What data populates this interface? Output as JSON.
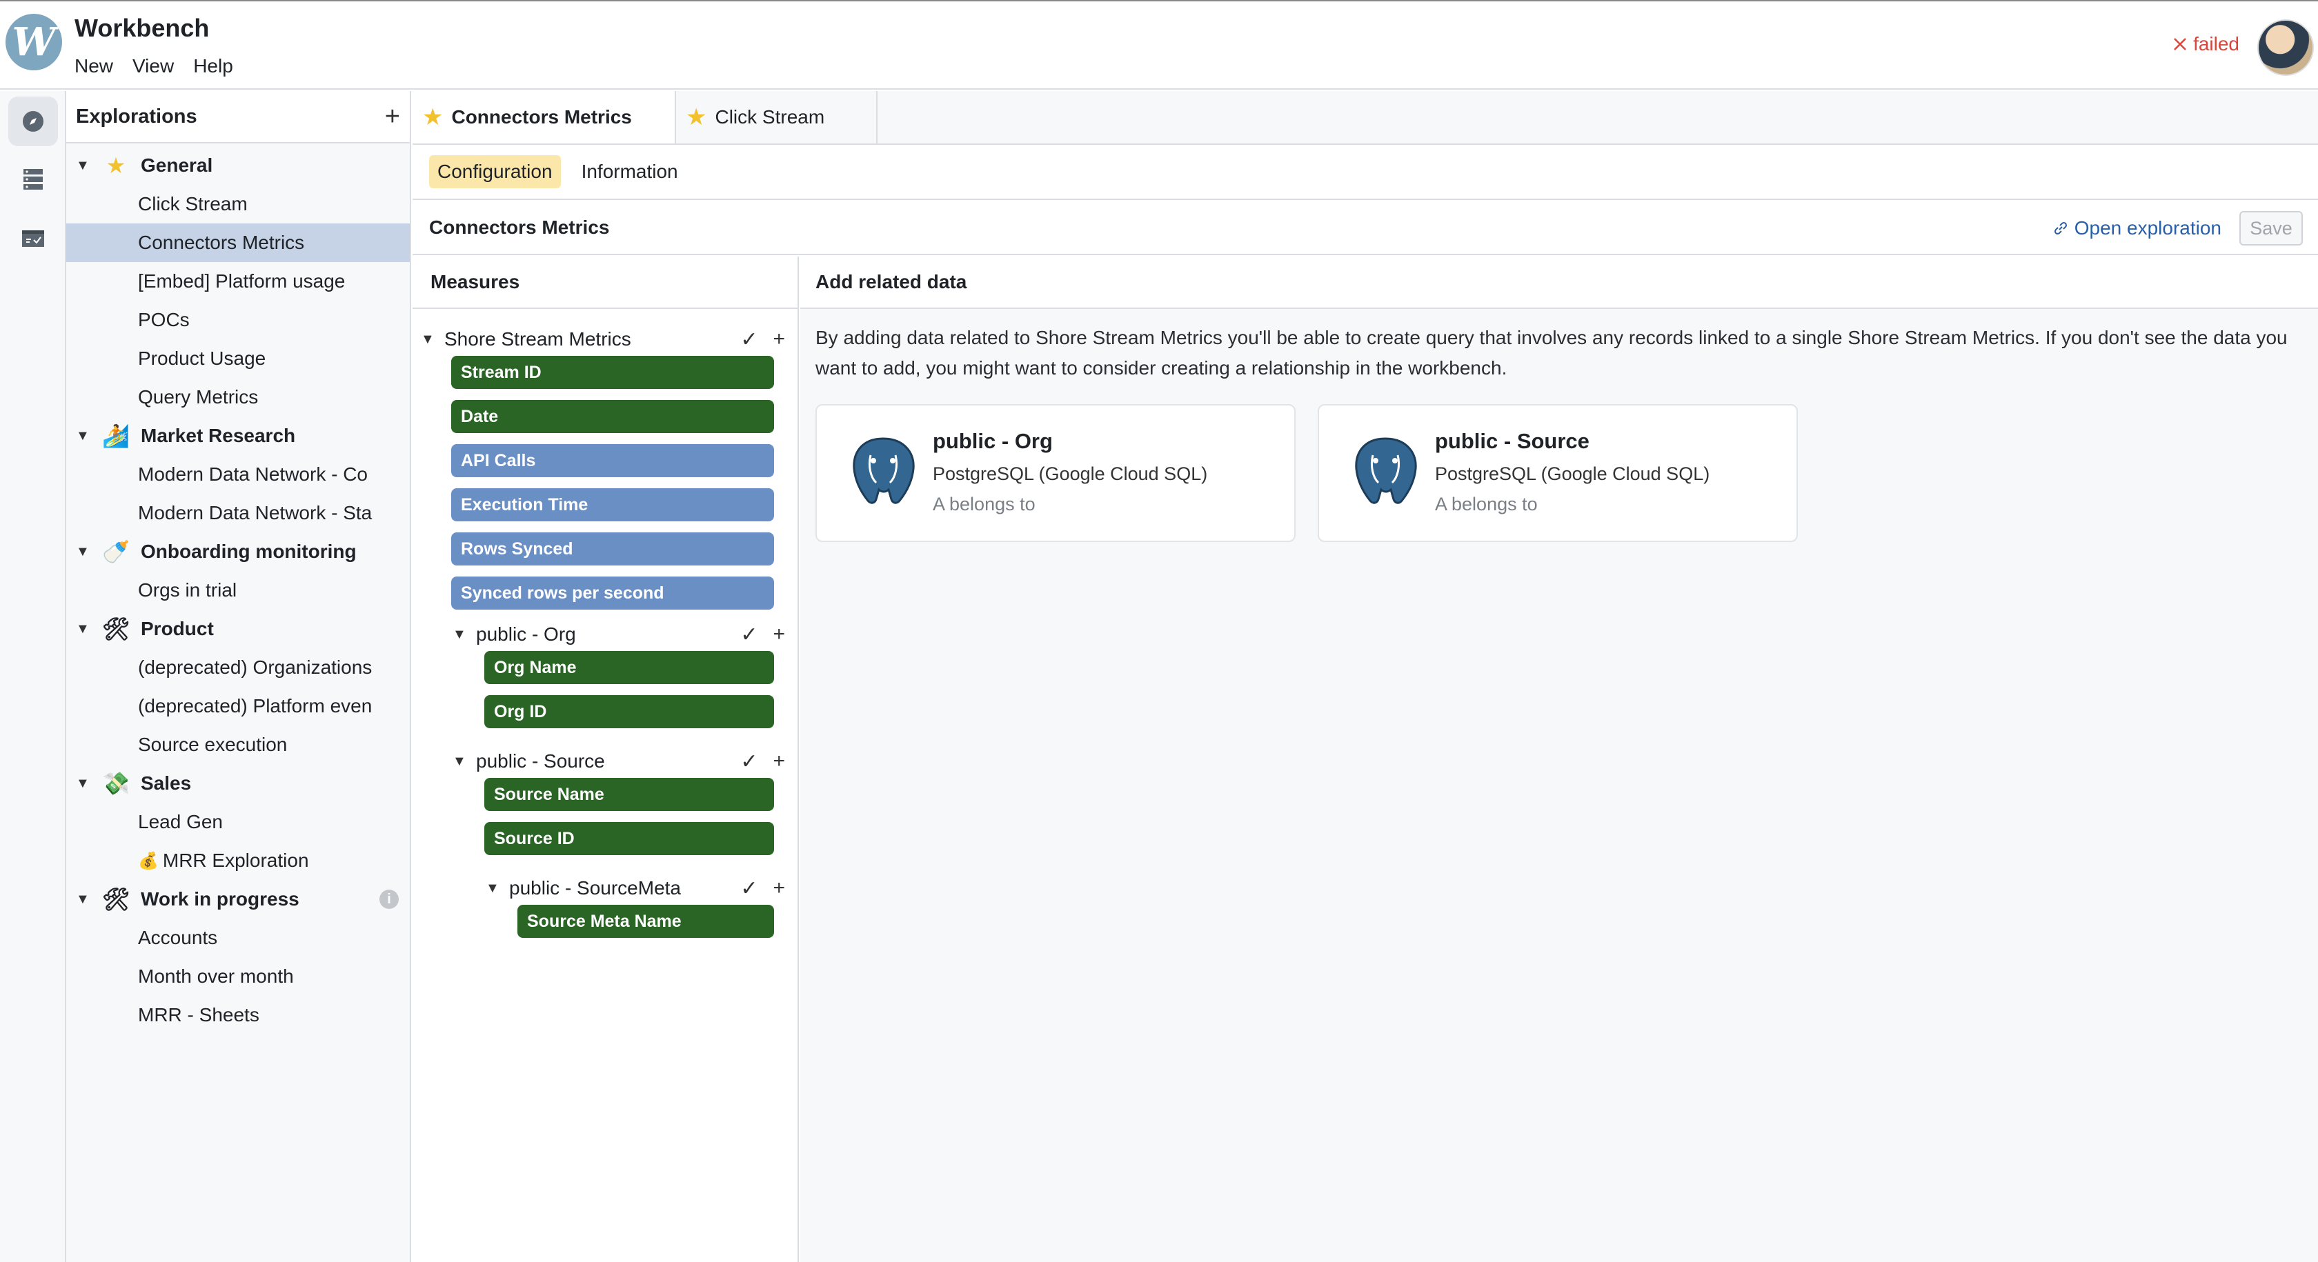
{
  "app": {
    "title": "Workbench",
    "logo_letter": "W"
  },
  "menu": [
    "New",
    "View",
    "Help"
  ],
  "status": {
    "icon": "x-icon",
    "text": "failed",
    "color": "#d9453a"
  },
  "rail": [
    "explore-icon",
    "database-icon",
    "calendar-check-icon"
  ],
  "sidebar": {
    "title": "Explorations",
    "groups": [
      {
        "label": "General",
        "icon": "star-icon",
        "items": [
          "Click Stream",
          "Connectors Metrics",
          "[Embed] Platform usage",
          "POCs",
          "Product Usage",
          "Query Metrics"
        ]
      },
      {
        "label": "Market Research",
        "icon": "surfer-icon",
        "items": [
          "Modern Data Network - Co",
          "Modern Data Network - Sta"
        ]
      },
      {
        "label": "Onboarding monitoring",
        "icon": "baby-bottle-icon",
        "items": [
          "Orgs in trial"
        ]
      },
      {
        "label": "Product",
        "icon": "tools-icon",
        "items": [
          "(deprecated) Organizations",
          "(deprecated) Platform even",
          "Source execution"
        ]
      },
      {
        "label": "Sales",
        "icon": "money-wings-icon",
        "items": [
          "Lead Gen",
          "MRR Exploration"
        ]
      },
      {
        "label": "Work in progress",
        "icon": "tools-icon",
        "items": [
          "Accounts",
          "Month over month",
          "MRR - Sheets"
        ]
      }
    ],
    "selected": "Connectors Metrics"
  },
  "tabs": [
    {
      "label": "Connectors Metrics",
      "active": true
    },
    {
      "label": "Click Stream",
      "active": false
    }
  ],
  "subtabs": [
    {
      "label": "Configuration",
      "active": true
    },
    {
      "label": "Information",
      "active": false
    }
  ],
  "exploration": {
    "name": "Connectors Metrics",
    "open_label": "Open exploration",
    "save_label": "Save"
  },
  "measures": {
    "title": "Measures",
    "root": "Shore Stream Metrics",
    "root_fields": [
      {
        "label": "Stream ID",
        "kind": "dimension"
      },
      {
        "label": "Date",
        "kind": "dimension"
      },
      {
        "label": "API Calls",
        "kind": "measure"
      },
      {
        "label": "Execution Time",
        "kind": "measure"
      },
      {
        "label": "Rows Synced",
        "kind": "measure"
      },
      {
        "label": "Synced rows per second",
        "kind": "measure"
      }
    ],
    "org": {
      "label": "public - Org",
      "fields": [
        "Org Name",
        "Org ID"
      ]
    },
    "source": {
      "label": "public - Source",
      "fields": [
        "Source Name",
        "Source ID"
      ]
    },
    "sourcemeta": {
      "label": "public - SourceMeta",
      "fields": [
        "Source Meta Name"
      ]
    }
  },
  "related": {
    "title": "Add related data",
    "description": "By adding data related to Shore Stream Metrics you'll be able to create query that involves any records linked to a single Shore Stream Metrics. If you don't see the data you want to add, you might want to consider creating a relationship in the workbench.",
    "cards": [
      {
        "name": "public - Org",
        "type": "PostgreSQL (Google Cloud SQL)",
        "relation": "A belongs to"
      },
      {
        "name": "public - Source",
        "type": "PostgreSQL (Google Cloud SQL)",
        "relation": "A belongs to"
      }
    ]
  },
  "colors": {
    "dimension": "#2a6526",
    "measure": "#6a8fc4",
    "selected": "#c6d3e6",
    "active_subtab": "#fbe7a9"
  }
}
